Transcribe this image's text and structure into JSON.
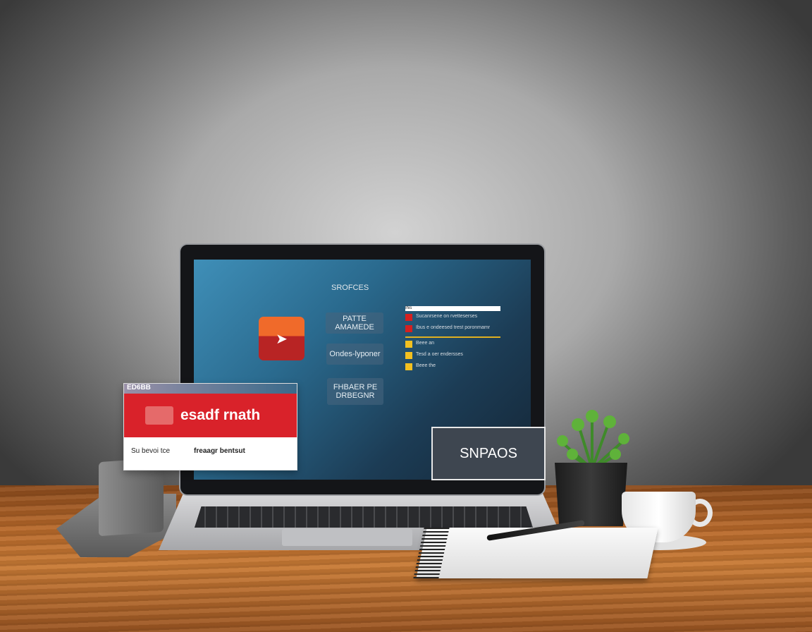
{
  "screen": {
    "title": "SROFCES",
    "buttons": [
      {
        "label": "PATTE AMAMEDE"
      },
      {
        "label": "Ondes-lyponer"
      },
      {
        "label": "FHBAER PE DRBEGNR"
      }
    ],
    "app_icon": "red-orange-app-icon",
    "list": {
      "search": "Ihis",
      "items": [
        {
          "icon_color": "#d52020",
          "text": "Sucanrsene on rvetteserses"
        },
        {
          "icon_color": "#d52020",
          "text": "Ibus e ondeesed trest poronmamr"
        },
        {
          "icon_color": "#f2c020",
          "text": "Beee an"
        },
        {
          "icon_color": "#f2c020",
          "text": "Tesd a oer endersses"
        },
        {
          "icon_color": "#f2c020",
          "text": "Beee the"
        }
      ]
    }
  },
  "red_card": {
    "tab": "ED6BB",
    "headline": "esadf rnath",
    "sub_left": "Su bevoi tce",
    "sub_right": "freaagr bentsut",
    "accent": "#d9222a"
  },
  "dark_card": {
    "label": "SNPAOS"
  }
}
